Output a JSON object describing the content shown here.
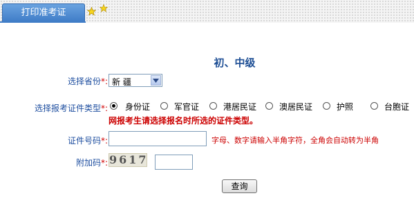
{
  "header": {
    "tab_label": "打印准考证"
  },
  "form": {
    "title": "初、中级",
    "province": {
      "label": "选择省份",
      "required_mark": "*:",
      "selected": "新 疆"
    },
    "id_type": {
      "label": "选择报考证件类型",
      "required_mark": "*:",
      "options": [
        "身份证",
        "军官证",
        "港居民证",
        "澳居民证",
        "护照",
        "台胞证"
      ],
      "selected_index": 0,
      "warning": "网报考生请选择报名时所选的证件类型。"
    },
    "id_number": {
      "label": "证件号码",
      "required_mark": "*:",
      "value": "",
      "hint": "字母、数字请输入半角字符，全角会自动转为半角"
    },
    "captcha": {
      "label": "附加码",
      "required_mark": "*:",
      "image_text": "9617",
      "value": ""
    },
    "submit_label": "查询"
  }
}
